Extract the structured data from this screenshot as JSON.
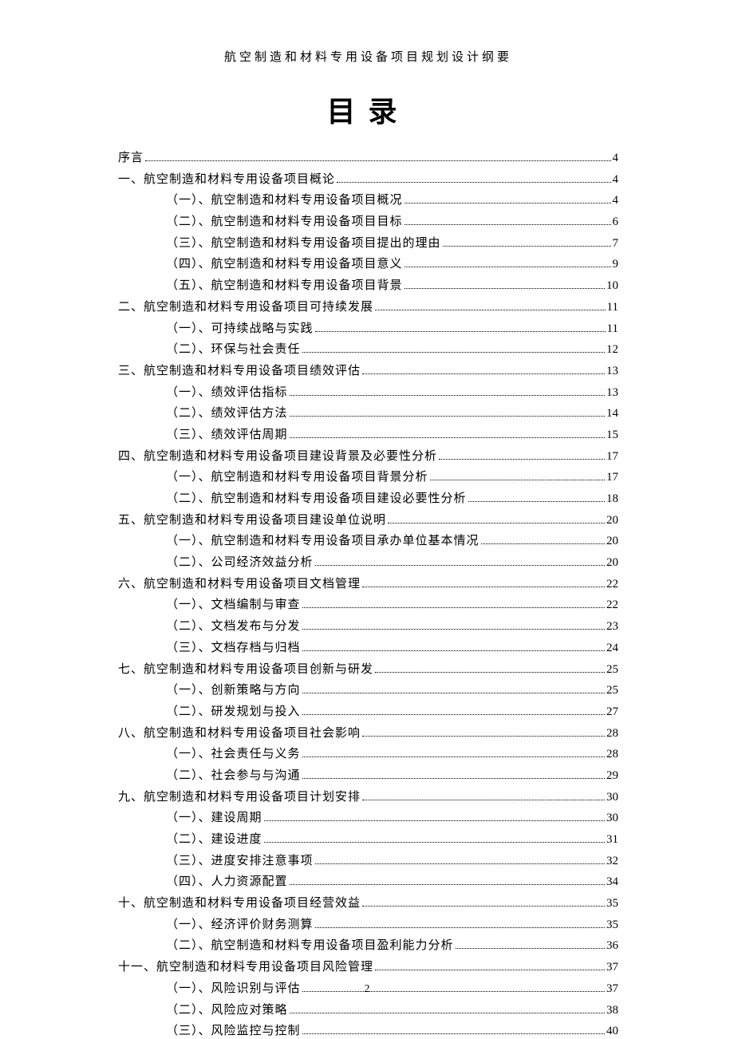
{
  "running_head": "航空制造和材料专用设备项目规划设计纲要",
  "title": "目录",
  "page_number": "2",
  "toc": [
    {
      "level": 1,
      "label": "序言",
      "page": "4"
    },
    {
      "level": 1,
      "label": "一、航空制造和材料专用设备项目概论",
      "page": "4"
    },
    {
      "level": 2,
      "label": "（一）、航空制造和材料专用设备项目概况",
      "page": "4"
    },
    {
      "level": 2,
      "label": "（二）、航空制造和材料专用设备项目目标",
      "page": "6"
    },
    {
      "level": 2,
      "label": "（三）、航空制造和材料专用设备项目提出的理由",
      "page": "7"
    },
    {
      "level": 2,
      "label": "（四）、航空制造和材料专用设备项目意义",
      "page": "9"
    },
    {
      "level": 2,
      "label": "（五）、航空制造和材料专用设备项目背景",
      "page": "10"
    },
    {
      "level": 1,
      "label": "二、航空制造和材料专用设备项目可持续发展",
      "page": "11"
    },
    {
      "level": 2,
      "label": "（一）、可持续战略与实践",
      "page": "11"
    },
    {
      "level": 2,
      "label": "（二）、环保与社会责任",
      "page": "12"
    },
    {
      "level": 1,
      "label": "三、航空制造和材料专用设备项目绩效评估",
      "page": "13"
    },
    {
      "level": 2,
      "label": "（一）、绩效评估指标",
      "page": "13"
    },
    {
      "level": 2,
      "label": "（二）、绩效评估方法",
      "page": "14"
    },
    {
      "level": 2,
      "label": "（三）、绩效评估周期",
      "page": "15"
    },
    {
      "level": 1,
      "label": "四、航空制造和材料专用设备项目建设背景及必要性分析",
      "page": "17"
    },
    {
      "level": 2,
      "label": "（一）、航空制造和材料专用设备项目背景分析",
      "page": "17"
    },
    {
      "level": 2,
      "label": "（二）、航空制造和材料专用设备项目建设必要性分析",
      "page": "18"
    },
    {
      "level": 1,
      "label": "五、航空制造和材料专用设备项目建设单位说明",
      "page": "20"
    },
    {
      "level": 2,
      "label": "（一）、航空制造和材料专用设备项目承办单位基本情况",
      "page": "20"
    },
    {
      "level": 2,
      "label": "（二）、公司经济效益分析",
      "page": "20"
    },
    {
      "level": 1,
      "label": "六、航空制造和材料专用设备项目文档管理",
      "page": "22"
    },
    {
      "level": 2,
      "label": "（一）、文档编制与审查",
      "page": "22"
    },
    {
      "level": 2,
      "label": "（二）、文档发布与分发",
      "page": "23"
    },
    {
      "level": 2,
      "label": "（三）、文档存档与归档",
      "page": "24"
    },
    {
      "level": 1,
      "label": "七、航空制造和材料专用设备项目创新与研发",
      "page": "25"
    },
    {
      "level": 2,
      "label": "（一）、创新策略与方向",
      "page": "25"
    },
    {
      "level": 2,
      "label": "（二）、研发规划与投入",
      "page": "27"
    },
    {
      "level": 1,
      "label": "八、航空制造和材料专用设备项目社会影响",
      "page": "28"
    },
    {
      "level": 2,
      "label": "（一）、社会责任与义务",
      "page": "28"
    },
    {
      "level": 2,
      "label": "（二）、社会参与与沟通",
      "page": "29"
    },
    {
      "level": 1,
      "label": "九、航空制造和材料专用设备项目计划安排",
      "page": "30"
    },
    {
      "level": 2,
      "label": "（一）、建设周期",
      "page": "30"
    },
    {
      "level": 2,
      "label": "（二）、建设进度",
      "page": "31"
    },
    {
      "level": 2,
      "label": "（三）、进度安排注意事项",
      "page": "32"
    },
    {
      "level": 2,
      "label": "（四）、人力资源配置",
      "page": "34"
    },
    {
      "level": 1,
      "label": "十、航空制造和材料专用设备项目经营效益",
      "page": "35"
    },
    {
      "level": 2,
      "label": "（一）、经济评价财务测算",
      "page": "35"
    },
    {
      "level": 2,
      "label": "（二）、航空制造和材料专用设备项目盈利能力分析",
      "page": "36"
    },
    {
      "level": 1,
      "label": "十一、航空制造和材料专用设备项目风险管理",
      "page": "37"
    },
    {
      "level": 2,
      "label": "（一）、风险识别与评估",
      "page": "37"
    },
    {
      "level": 2,
      "label": "（二）、风险应对策略",
      "page": "38"
    },
    {
      "level": 2,
      "label": "（三）、风险监控与控制",
      "page": "40"
    }
  ]
}
